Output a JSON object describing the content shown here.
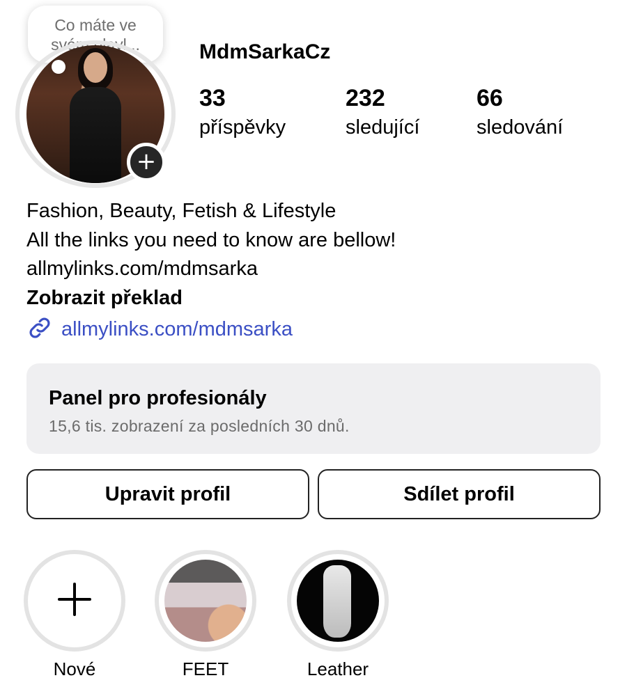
{
  "note": {
    "text_line1": "Co máte ve",
    "text_line2": "svém playl..."
  },
  "profile": {
    "username": "MdmSarkaCz"
  },
  "stats": [
    {
      "value": "33",
      "label": "příspěvky"
    },
    {
      "value": "232",
      "label": "sledující"
    },
    {
      "value": "66",
      "label": "sledování"
    }
  ],
  "bio": {
    "line1": "Fashion, Beauty, Fetish & Lifestyle",
    "line2": "All the links you need to know are bellow!",
    "line3": "allmylinks.com/mdmsarka",
    "translate": "Zobrazit překlad",
    "link": "allmylinks.com/mdmsarka"
  },
  "dashboard": {
    "title": "Panel pro profesionály",
    "subtitle": "15,6 tis. zobrazení za posledních 30 dnů."
  },
  "buttons": {
    "edit": "Upravit profil",
    "share": "Sdílet profil"
  },
  "highlights": [
    {
      "label": "Nové",
      "icon": "plus-icon"
    },
    {
      "label": "FEET"
    },
    {
      "label": "Leather"
    }
  ],
  "colors": {
    "link": "#3b4fc4",
    "panel_bg": "#efeff1"
  }
}
